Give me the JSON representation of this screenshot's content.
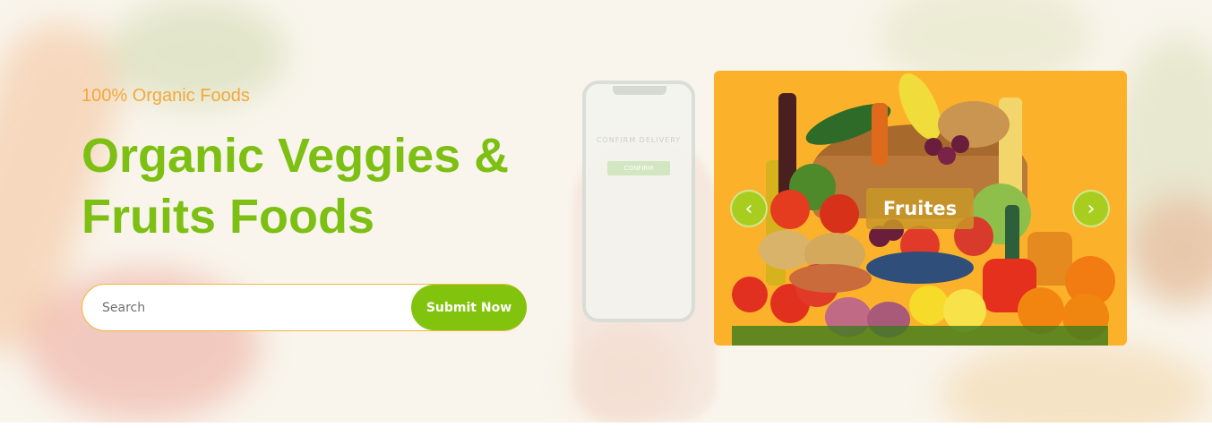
{
  "hero": {
    "tagline": "100% Organic Foods",
    "headline_line1": "Organic Veggies &",
    "headline_line2": "Fruits Foods",
    "phone": {
      "screen_title": "CONFIRM DELIVERY",
      "screen_button": "CONFIRM"
    }
  },
  "search": {
    "placeholder": "Search",
    "value": "",
    "submit_label": "Submit Now"
  },
  "slider": {
    "current_label": "Fruites",
    "prev_icon": "‹",
    "next_icon": "›"
  },
  "colors": {
    "accent_green": "#7dc013",
    "accent_orange": "#f3a83b",
    "slider_bg": "#fbb22a"
  }
}
